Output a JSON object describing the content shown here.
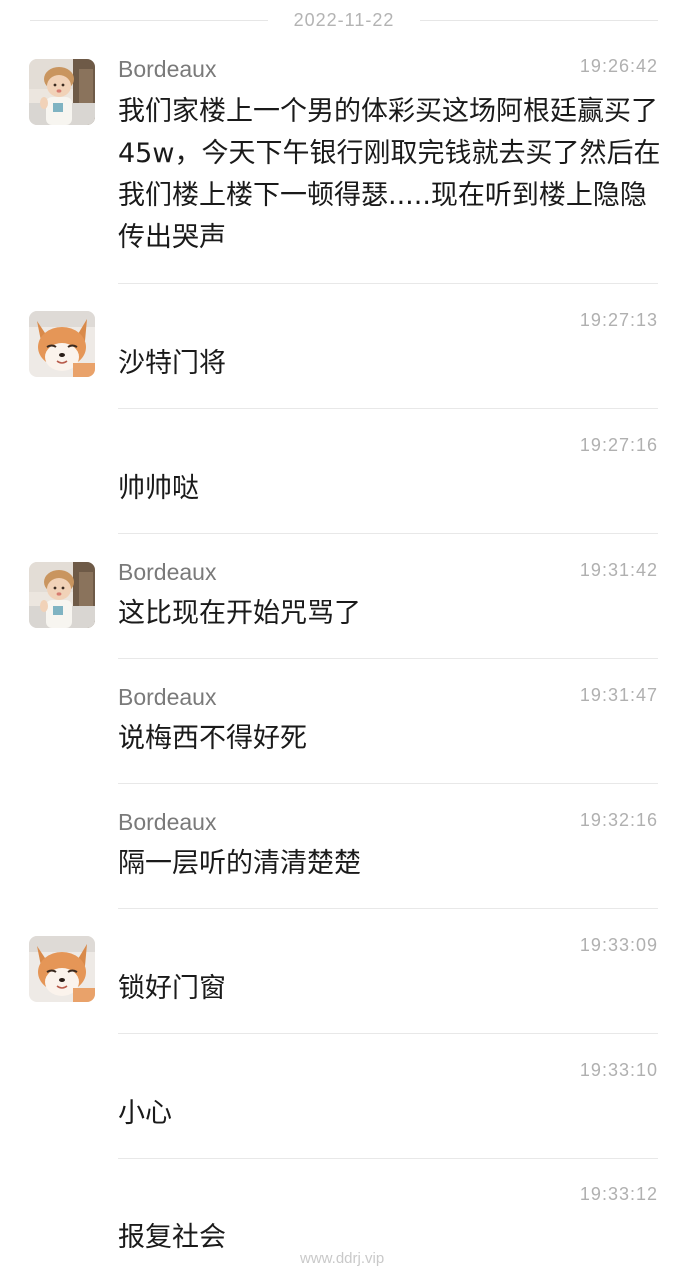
{
  "date": "2022-11-22",
  "watermark": "www.ddrj.vip",
  "messages": [
    {
      "sender": "Bordeaux",
      "time": "19:26:42",
      "text": "我们家楼上一个男的体彩买这场阿根廷赢买了45w，今天下午银行刚取完钱就去买了然后在我们楼上楼下一顿得瑟.....现在听到楼上隐隐传出哭声",
      "avatar": "child-avatar"
    },
    {
      "sender": "",
      "time": "19:27:13",
      "text": "沙特门将",
      "avatar": "fox-avatar"
    },
    {
      "sender": "",
      "time": "19:27:16",
      "text": "帅帅哒",
      "avatar": ""
    },
    {
      "sender": "Bordeaux",
      "time": "19:31:42",
      "text": "这比现在开始咒骂了",
      "avatar": "child-avatar"
    },
    {
      "sender": "Bordeaux",
      "time": "19:31:47",
      "text": "说梅西不得好死",
      "avatar": ""
    },
    {
      "sender": "Bordeaux",
      "time": "19:32:16",
      "text": "隔一层听的清清楚楚",
      "avatar": ""
    },
    {
      "sender": "",
      "time": "19:33:09",
      "text": "锁好门窗",
      "avatar": "fox-avatar"
    },
    {
      "sender": "",
      "time": "19:33:10",
      "text": "小心",
      "avatar": ""
    },
    {
      "sender": "",
      "time": "19:33:12",
      "text": "报复社会",
      "avatar": ""
    }
  ]
}
